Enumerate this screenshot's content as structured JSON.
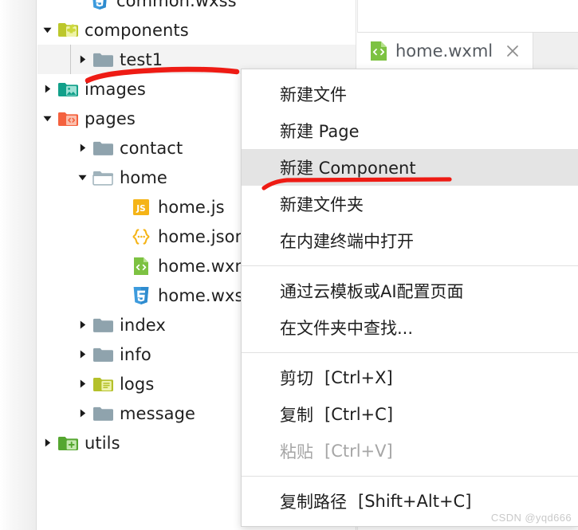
{
  "app": {
    "accent_red": "#ee1b14",
    "selected_row_bg": "#f3f3f3",
    "menu_highlight_bg": "#e4e4e4"
  },
  "explorer": {
    "name": "file-explorer",
    "items": [
      {
        "label": "common.wxss",
        "icon": "wxss-file-icon",
        "indent": 88,
        "twisty": "none",
        "type": "file",
        "selected": false
      },
      {
        "label": "components",
        "icon": "folder-components-icon",
        "indent": 48,
        "twisty": "expanded",
        "type": "folder",
        "selected": false
      },
      {
        "label": "test1",
        "icon": "folder-plain-icon",
        "indent": 92,
        "twisty": "collapsed",
        "type": "folder",
        "selected": true
      },
      {
        "label": "images",
        "icon": "folder-images-icon",
        "indent": 48,
        "twisty": "collapsed",
        "type": "folder",
        "selected": false
      },
      {
        "label": "pages",
        "icon": "folder-pages-icon",
        "indent": 48,
        "twisty": "expanded",
        "type": "folder",
        "selected": false
      },
      {
        "label": "contact",
        "icon": "folder-plain-icon",
        "indent": 92,
        "twisty": "collapsed",
        "type": "folder",
        "selected": false
      },
      {
        "label": "home",
        "icon": "folder-open-icon",
        "indent": 92,
        "twisty": "expanded",
        "type": "folder",
        "selected": false
      },
      {
        "label": "home.js",
        "icon": "js-file-icon",
        "indent": 140,
        "twisty": "none",
        "type": "file",
        "selected": false
      },
      {
        "label": "home.json",
        "icon": "json-file-icon",
        "indent": 140,
        "twisty": "none",
        "type": "file",
        "selected": false
      },
      {
        "label": "home.wxml",
        "icon": "wxml-file-icon",
        "indent": 140,
        "twisty": "none",
        "type": "file",
        "selected": false
      },
      {
        "label": "home.wxss",
        "icon": "wxss-file-icon",
        "indent": 140,
        "twisty": "none",
        "type": "file",
        "selected": false
      },
      {
        "label": "index",
        "icon": "folder-plain-icon",
        "indent": 92,
        "twisty": "collapsed",
        "type": "folder",
        "selected": false
      },
      {
        "label": "info",
        "icon": "folder-plain-icon",
        "indent": 92,
        "twisty": "collapsed",
        "type": "folder",
        "selected": false
      },
      {
        "label": "logs",
        "icon": "folder-logs-icon",
        "indent": 92,
        "twisty": "collapsed",
        "type": "folder",
        "selected": false
      },
      {
        "label": "message",
        "icon": "folder-plain-icon",
        "indent": 92,
        "twisty": "collapsed",
        "type": "folder",
        "selected": false
      },
      {
        "label": "utils",
        "icon": "folder-utils-icon",
        "indent": 48,
        "twisty": "collapsed",
        "type": "folder",
        "selected": false
      }
    ]
  },
  "editor": {
    "tab": {
      "label": "home.wxml",
      "icon": "wxml-file-icon",
      "close_icon": "close-icon",
      "active": true
    }
  },
  "context_menu": {
    "name": "file-tree-context-menu",
    "groups": [
      [
        {
          "label": "新建文件",
          "accel": "",
          "state": "normal"
        },
        {
          "label": "新建 Page",
          "accel": "",
          "state": "normal"
        },
        {
          "label": "新建 Component",
          "accel": "",
          "state": "highlight"
        },
        {
          "label": "新建文件夹",
          "accel": "",
          "state": "normal"
        },
        {
          "label": "在内建终端中打开",
          "accel": "",
          "state": "normal"
        }
      ],
      [
        {
          "label": "通过云模板或AI配置页面",
          "accel": "",
          "state": "normal"
        },
        {
          "label": "在文件夹中查找...",
          "accel": "",
          "state": "normal"
        }
      ],
      [
        {
          "label": "剪切",
          "accel": "[Ctrl+X]",
          "state": "normal"
        },
        {
          "label": "复制",
          "accel": "[Ctrl+C]",
          "state": "normal"
        },
        {
          "label": "粘贴",
          "accel": "[Ctrl+V]",
          "state": "disabled"
        }
      ],
      [
        {
          "label": "复制路径",
          "accel": "[Shift+Alt+C]",
          "state": "normal"
        }
      ]
    ]
  },
  "annotations": [
    {
      "name": "red-underline-test1",
      "color": "#ee1b14"
    },
    {
      "name": "red-underline-new-component",
      "color": "#ee1b14"
    }
  ],
  "watermark": {
    "text": "CSDN @yqd666"
  }
}
